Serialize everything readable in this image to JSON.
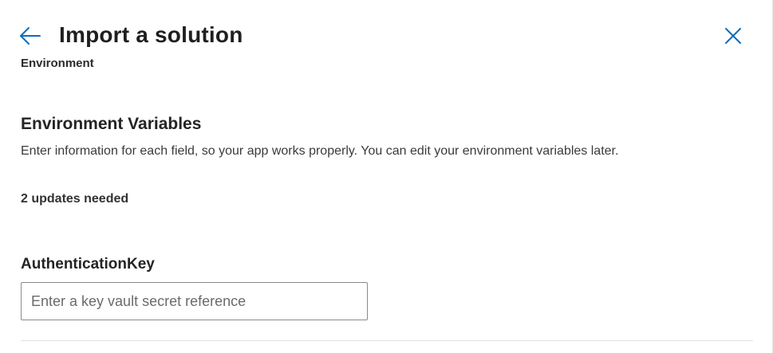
{
  "header": {
    "title": "Import a solution",
    "back_icon": "arrow-left-icon",
    "close_icon": "close-icon",
    "accent_color": "#0f6cbd"
  },
  "breadcrumb": {
    "label": "Environment"
  },
  "section": {
    "title": "Environment Variables",
    "description": "Enter information for each field, so your app works properly. You can edit your environment variables later.",
    "updates_needed": "2 updates needed"
  },
  "fields": [
    {
      "label": "AuthenticationKey",
      "value": "",
      "placeholder": "Enter a key vault secret reference"
    }
  ]
}
